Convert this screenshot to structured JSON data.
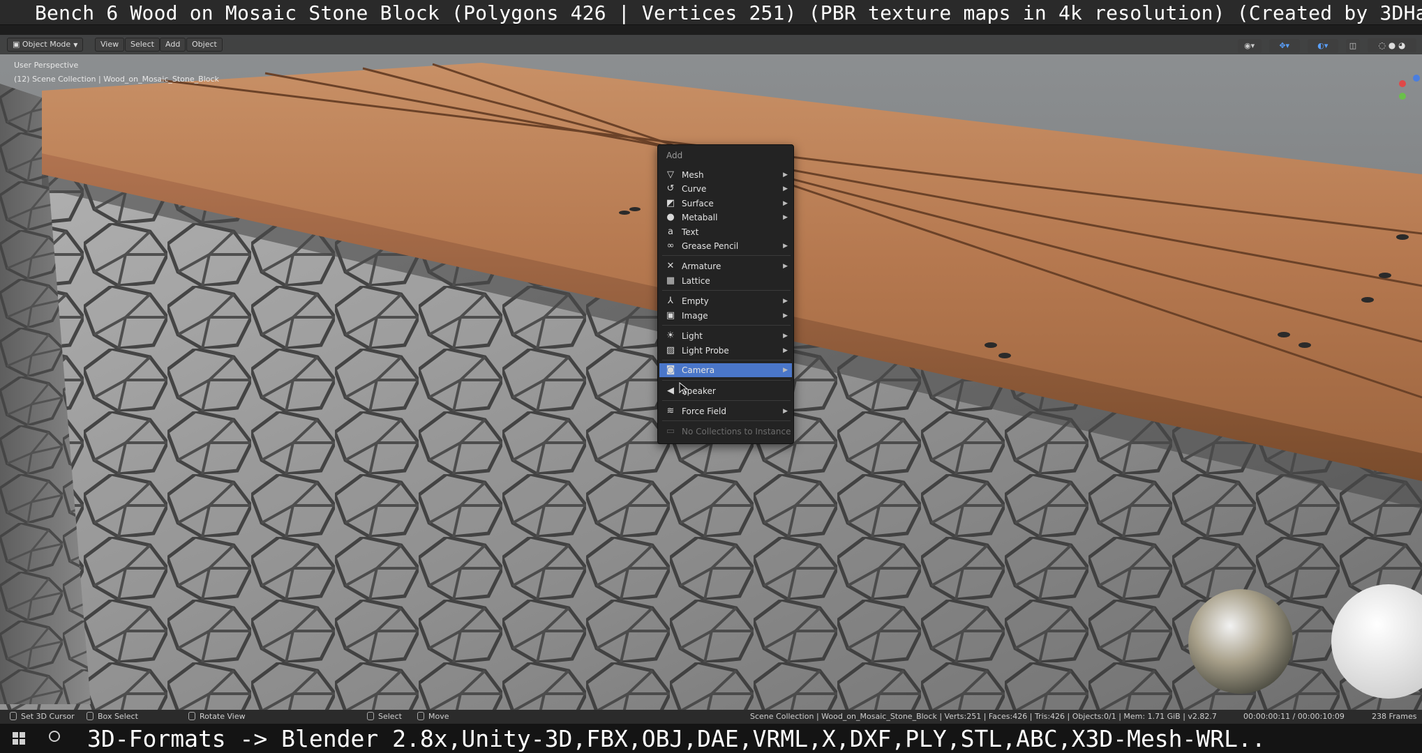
{
  "banner": {
    "title": "Bench 6 Wood on Mosaic Stone Block (Polygons 426 | Vertices 251) (PBR texture maps in 4k resolution) (Created by 3DHaupt)"
  },
  "header": {
    "mode_label": "Object Mode",
    "menu_view": "View",
    "menu_select": "Select",
    "menu_add": "Add",
    "menu_object": "Object"
  },
  "viewport_info": {
    "perspective": "User Perspective",
    "collection": "(12) Scene Collection | Wood_on_Mosaic_Stone_Block"
  },
  "add_menu": {
    "title": "Add",
    "items": [
      {
        "label": "Mesh",
        "icon": "mesh-icon",
        "submenu": true
      },
      {
        "label": "Curve",
        "icon": "curve-icon",
        "submenu": true
      },
      {
        "label": "Surface",
        "icon": "surface-icon",
        "submenu": true
      },
      {
        "label": "Metaball",
        "icon": "metaball-icon",
        "submenu": true
      },
      {
        "label": "Text",
        "icon": "text-icon",
        "submenu": false
      },
      {
        "label": "Grease Pencil",
        "icon": "grease-pencil-icon",
        "submenu": true
      },
      {
        "label": "Armature",
        "icon": "armature-icon",
        "submenu": true
      },
      {
        "label": "Lattice",
        "icon": "lattice-icon",
        "submenu": false
      },
      {
        "label": "Empty",
        "icon": "empty-icon",
        "submenu": true
      },
      {
        "label": "Image",
        "icon": "image-icon",
        "submenu": true
      },
      {
        "label": "Light",
        "icon": "light-icon",
        "submenu": true
      },
      {
        "label": "Light Probe",
        "icon": "light-probe-icon",
        "submenu": true
      },
      {
        "label": "Camera",
        "icon": "camera-icon",
        "submenu": true,
        "active": true
      },
      {
        "label": "Speaker",
        "icon": "speaker-icon",
        "submenu": false
      },
      {
        "label": "Force Field",
        "icon": "force-field-icon",
        "submenu": true
      },
      {
        "label": "No Collections to Instance",
        "icon": "collection-icon",
        "submenu": false,
        "disabled": true
      }
    ]
  },
  "statusbar": {
    "set_cursor": "Set 3D Cursor",
    "box_select": "Box Select",
    "rotate_view": "Rotate View",
    "select": "Select",
    "move": "Move",
    "scene_stats": "Scene Collection | Wood_on_Mosaic_Stone_Block | Verts:251 | Faces:426 | Tris:426 | Objects:0/1 | Mem: 1.71 GiB | v2.82.7",
    "timecode": "00:00:00:11 / 00:00:10:09",
    "frames": "238 Frames"
  },
  "caption": {
    "text": "3D-Formats -> Blender 2.8x,Unity-3D,FBX,OBJ,DAE,VRML,X,DXF,PLY,STL,ABC,X3D-Mesh-WRL.."
  },
  "colors": {
    "menu_highlight": "#4a76c9",
    "wood": "#b98258",
    "stone": "#9a9a9a"
  }
}
